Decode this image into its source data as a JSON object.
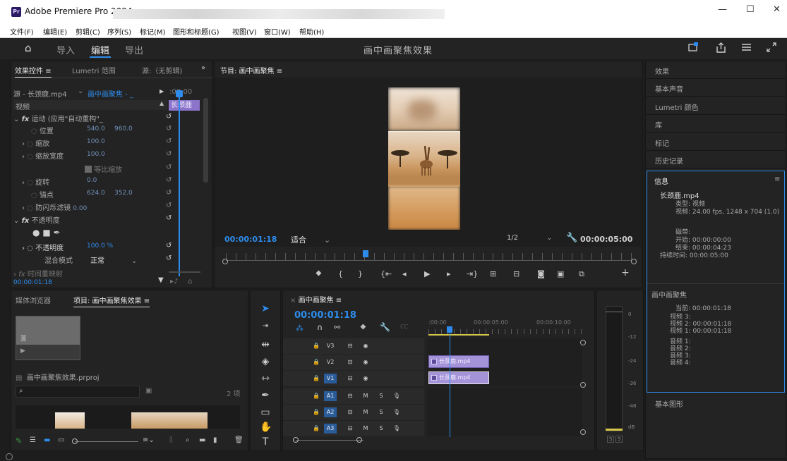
{
  "window": {
    "app_title": "Adobe Premiere Pro 2024",
    "app_badge": "Pr",
    "min": "—",
    "max": "☐",
    "close": "✕"
  },
  "menu": [
    "文件(F)",
    "编辑(E)",
    "剪辑(C)",
    "序列(S)",
    "标记(M)",
    "图形和标题(G)",
    "视图(V)",
    "窗口(W)",
    "帮助(H)"
  ],
  "header": {
    "home": "⌂",
    "import": "导入",
    "edit": "编辑",
    "export": "导出",
    "project_title": "画中画聚焦效果"
  },
  "effect_controls": {
    "tab_effects": "效果控件",
    "tab_effects_menu": "≡",
    "tab_lumetri": "Lumetri 范围",
    "tab_source": "源:（无剪辑)",
    "more": "»",
    "source_label": "源 - 长颈鹿.mp4",
    "sequence_label": "画中画聚焦 - _",
    "ruler_time": ":00:00",
    "clip_label": "长颈鹿",
    "video_heading": "视频",
    "motion": "运动 (应用\"自动重构\"_",
    "position_label": "位置",
    "position_x": "540.0",
    "position_y": "960.0",
    "scale_label": "缩放",
    "scale_value": "100.0",
    "scale_width_label": "缩放宽度",
    "scale_width_value": "100.0",
    "uniform_scale": "等比缩放",
    "rotation_label": "旋转",
    "rotation_value": "0.0",
    "anchor_label": "锚点",
    "anchor_x": "624.0",
    "anchor_y": "352.0",
    "anti_flicker": "防闪烁滤镜",
    "anti_flicker_value": "0.00",
    "opacity_heading": "不透明度",
    "opacity_label": "不透明度",
    "opacity_value": "100.0 %",
    "blend_label": "混合模式",
    "blend_value": "正常",
    "time_remap": "时间重映射",
    "timecode": "00:00:01:18"
  },
  "program": {
    "tab": "节目: 画中画聚焦",
    "menu": "≡",
    "timecode": "00:00:01:18",
    "fit": "适合",
    "resolution": "1/2",
    "duration": "00:00:05:00"
  },
  "right_panels": [
    "效果",
    "基本声音",
    "Lumetri 颜色",
    "库",
    "标记",
    "历史记录"
  ],
  "info": {
    "title": "信息",
    "menu": "≡",
    "clip_name": "长颈鹿.mp4",
    "type_label": "类型: 视频",
    "video_label": "视频: 24.00 fps, 1248 x 704 (1.0)",
    "tape_label": "磁带:",
    "start_label": "开始: 00:00:00:00",
    "end_label": "结束: 00:00:04:23",
    "duration_label": "持续时间: 00:00:05:00",
    "seq_title": "画中画聚焦",
    "current": "当前: 00:00:01:18",
    "v3": "视频 3:",
    "v2": "视频 2: 00:00:01:18",
    "v1": "视频 1: 00:00:01:18",
    "a1": "音频 1:",
    "a2": "音频 2:",
    "a3": "音频 3:",
    "a4": "音频 4:"
  },
  "essential_graphics": "基本图形",
  "project": {
    "tab_media": "媒体浏览器",
    "tab_project": "项目: 画中画聚焦效果",
    "menu": "≡",
    "filename": "画中画聚焦效果.prproj",
    "count": "2 项"
  },
  "timeline": {
    "tab": "画中画聚焦",
    "menu": "≡",
    "close": "×",
    "timecode": "00:00:01:18",
    "ruler": [
      ":00:00",
      "00:00:05:00",
      "00:00:10:00"
    ],
    "tracks_video": [
      "V3",
      "V2",
      "V1"
    ],
    "tracks_audio": [
      "A1",
      "A2",
      "A3"
    ],
    "clip_v2": "长颈鹿.mp4",
    "clip_v1": "长颈鹿.mp4",
    "mute": "M",
    "solo": "S"
  },
  "meter": {
    "labels": [
      "0",
      "-12",
      "-24",
      "-36",
      "-48",
      "dB"
    ],
    "solo": [
      "S",
      "S"
    ]
  }
}
